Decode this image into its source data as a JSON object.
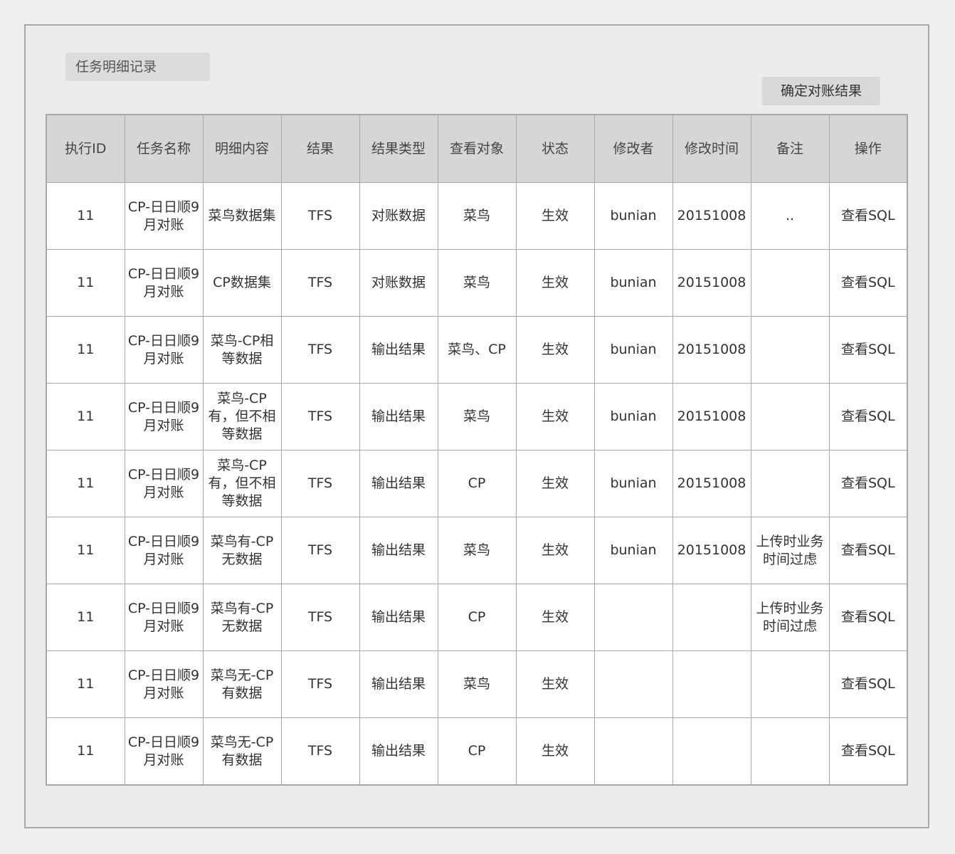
{
  "page": {
    "title": "任务明细记录",
    "confirm_button": "确定对账结果"
  },
  "table": {
    "columns": [
      "执行ID",
      "任务名称",
      "明细内容",
      "结果",
      "结果类型",
      "查看对象",
      "状态",
      "修改者",
      "修改时间",
      "备注",
      "操作"
    ],
    "rows": [
      {
        "id": "11",
        "task": "CP-日日顺9月对账",
        "detail": "菜鸟数据集",
        "result": "TFS",
        "type": "对账数据",
        "target": "菜鸟",
        "status": "生效",
        "modifier": "bunian",
        "time": "20151008",
        "note": "..",
        "action": "查看SQL"
      },
      {
        "id": "11",
        "task": "CP-日日顺9月对账",
        "detail": "CP数据集",
        "result": "TFS",
        "type": "对账数据",
        "target": "菜鸟",
        "status": "生效",
        "modifier": "bunian",
        "time": "20151008",
        "note": "",
        "action": "查看SQL"
      },
      {
        "id": "11",
        "task": "CP-日日顺9月对账",
        "detail": "菜鸟-CP相等数据",
        "result": "TFS",
        "type": "输出结果",
        "target": "菜鸟、CP",
        "status": "生效",
        "modifier": "bunian",
        "time": "20151008",
        "note": "",
        "action": "查看SQL"
      },
      {
        "id": "11",
        "task": "CP-日日顺9月对账",
        "detail": "菜鸟-CP有，但不相等数据",
        "result": "TFS",
        "type": "输出结果",
        "target": "菜鸟",
        "status": "生效",
        "modifier": "bunian",
        "time": "20151008",
        "note": "",
        "action": "查看SQL"
      },
      {
        "id": "11",
        "task": "CP-日日顺9月对账",
        "detail": "菜鸟-CP有，但不相等数据",
        "result": "TFS",
        "type": "输出结果",
        "target": "CP",
        "status": "生效",
        "modifier": "bunian",
        "time": "20151008",
        "note": "",
        "action": "查看SQL"
      },
      {
        "id": "11",
        "task": "CP-日日顺9月对账",
        "detail": "菜鸟有-CP无数据",
        "result": "TFS",
        "type": "输出结果",
        "target": "菜鸟",
        "status": "生效",
        "modifier": "bunian",
        "time": "20151008",
        "note": "上传时业务时间过虑",
        "action": "查看SQL"
      },
      {
        "id": "11",
        "task": "CP-日日顺9月对账",
        "detail": "菜鸟有-CP无数据",
        "result": "TFS",
        "type": "输出结果",
        "target": "CP",
        "status": "生效",
        "modifier": "",
        "time": "",
        "note": "上传时业务时间过虑",
        "action": "查看SQL"
      },
      {
        "id": "11",
        "task": "CP-日日顺9月对账",
        "detail": "菜鸟无-CP有数据",
        "result": "TFS",
        "type": "输出结果",
        "target": "菜鸟",
        "status": "生效",
        "modifier": "",
        "time": "",
        "note": "",
        "action": "查看SQL"
      },
      {
        "id": "11",
        "task": "CP-日日顺9月对账",
        "detail": "菜鸟无-CP有数据",
        "result": "TFS",
        "type": "输出结果",
        "target": "CP",
        "status": "生效",
        "modifier": "",
        "time": "",
        "note": "",
        "action": "查看SQL"
      }
    ]
  }
}
